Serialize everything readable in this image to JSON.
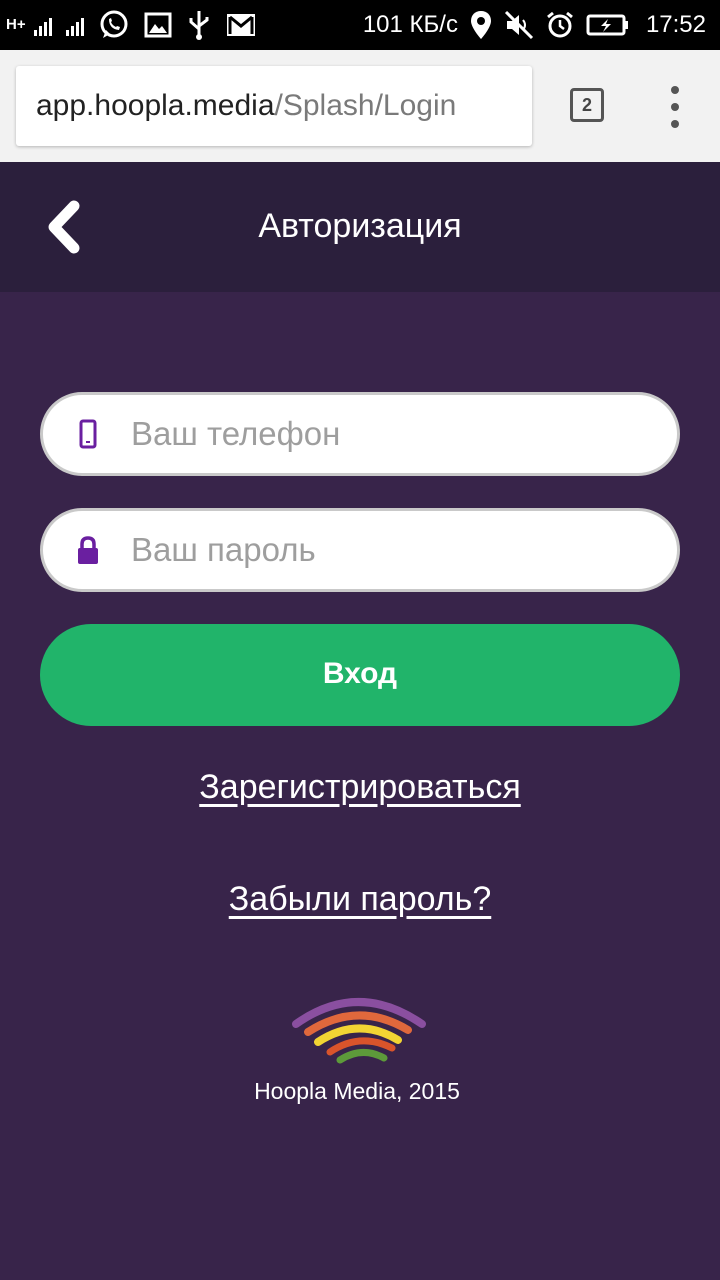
{
  "status_bar": {
    "network_type": "H+",
    "speed": "101 КБ/с",
    "time": "17:52",
    "icons": [
      "signal-icon",
      "signal-icon",
      "whatsapp-icon",
      "gallery-icon",
      "usb-icon",
      "gmail-icon",
      "location-icon",
      "mute-icon",
      "alarm-icon",
      "battery-icon"
    ]
  },
  "browser": {
    "url_domain": "app.hoopla.media",
    "url_path": "/Splash/Login",
    "tab_count": "2"
  },
  "header": {
    "title": "Авторизация"
  },
  "form": {
    "phone_placeholder": "Ваш телефон",
    "password_placeholder": "Ваш пароль",
    "login_label": "Вход"
  },
  "links": {
    "register": "Зарегистрироваться",
    "forgot": "Забыли пароль?"
  },
  "footer": {
    "copyright": "Hoopla Media, 2015"
  },
  "colors": {
    "background": "#38244a",
    "header_bg": "#2b1f3c",
    "button": "#21b46a",
    "field_icon": "#6a1fa0"
  }
}
